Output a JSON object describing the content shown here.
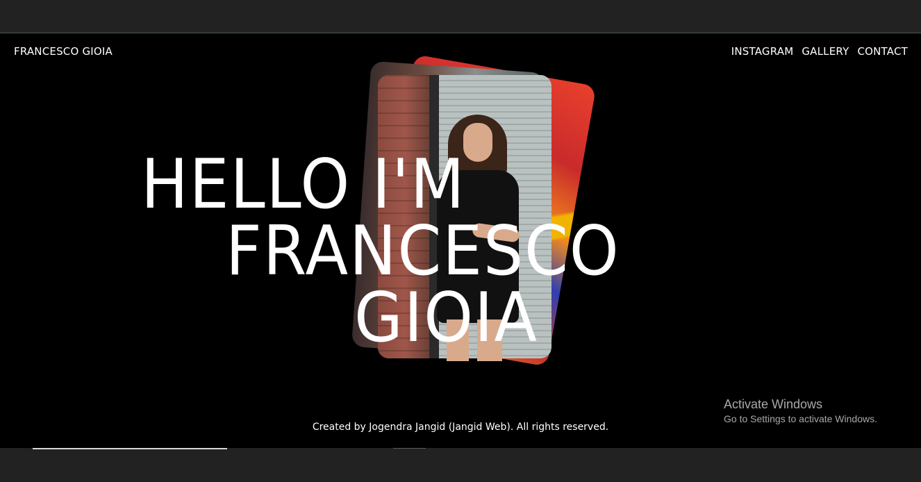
{
  "header": {
    "brand": "FRANCESCO GIOIA",
    "nav": [
      {
        "label": "INSTAGRAM"
      },
      {
        "label": "GALLERY"
      },
      {
        "label": "CONTACT"
      }
    ]
  },
  "hero": {
    "line1": "HELLO I'M",
    "line2": "FRANCESCO",
    "line3": "GIOIA"
  },
  "footer": {
    "credit": "Created by Jogendra Jangid (Jangid Web). All rights reserved."
  },
  "os_watermark": {
    "title": "Activate Windows",
    "subtitle": "Go to Settings to activate Windows."
  },
  "colors": {
    "background": "#000000",
    "text": "#ffffff",
    "chrome": "#232223",
    "watermark": "#a9a9a9"
  }
}
